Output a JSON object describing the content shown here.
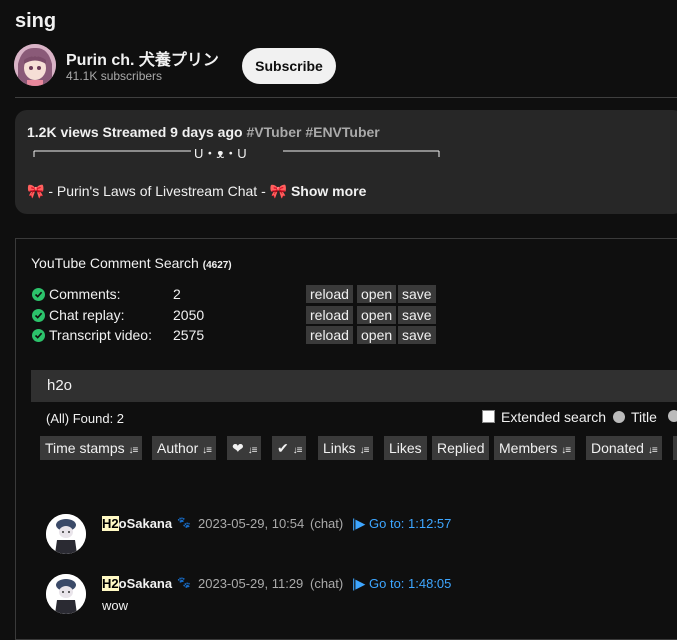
{
  "video": {
    "title": "sing"
  },
  "channel": {
    "name": "Purin ch. 犬養プリン",
    "subscribers": "41.1K subscribers",
    "subscribe_label": "Subscribe"
  },
  "description": {
    "stats": "1.2K views  Streamed 9 days ago",
    "tags": "#VTuber #ENVTuber",
    "deco": "U・ᴥ・U",
    "line2": "🎀 - Purin's Laws of Livestream Chat  - 🎀",
    "show_more": "Show more"
  },
  "extension": {
    "title": "YouTube Comment Search",
    "count": "(4627)",
    "rows": [
      {
        "label": "Comments:",
        "value": "2"
      },
      {
        "label": "Chat replay:",
        "value": "2050"
      },
      {
        "label": "Transcript video:",
        "value": "2575"
      }
    ],
    "buttons": {
      "reload": "reload",
      "open": "open",
      "save": "save"
    },
    "search_value": "h2o",
    "found": "(All) Found: 2",
    "extended_search": "Extended search",
    "title_option": "Title",
    "filters": {
      "time_stamps": "Time stamps",
      "author": "Author",
      "heart": "❤",
      "check": "✔",
      "links": "Links",
      "likes": "Likes",
      "replied": "Replied",
      "members": "Members",
      "donated": "Donated"
    }
  },
  "results": [
    {
      "author_highlight": "H2",
      "author_rest": "oSakana",
      "datetime": "2023-05-29, 10:54",
      "type": "(chat)",
      "goto": "Go to: 1:12:57",
      "text": ""
    },
    {
      "author_highlight": "H2",
      "author_rest": "oSakana",
      "datetime": "2023-05-29, 11:29",
      "type": "(chat)",
      "goto": "Go to: 1:48:05",
      "text": "wow"
    }
  ],
  "colors": {
    "background": "#0f0f0f",
    "panel": "#272727",
    "accent_link": "#3ea6ff",
    "check_green": "#2cc36b",
    "highlight": "#fff9c4"
  }
}
